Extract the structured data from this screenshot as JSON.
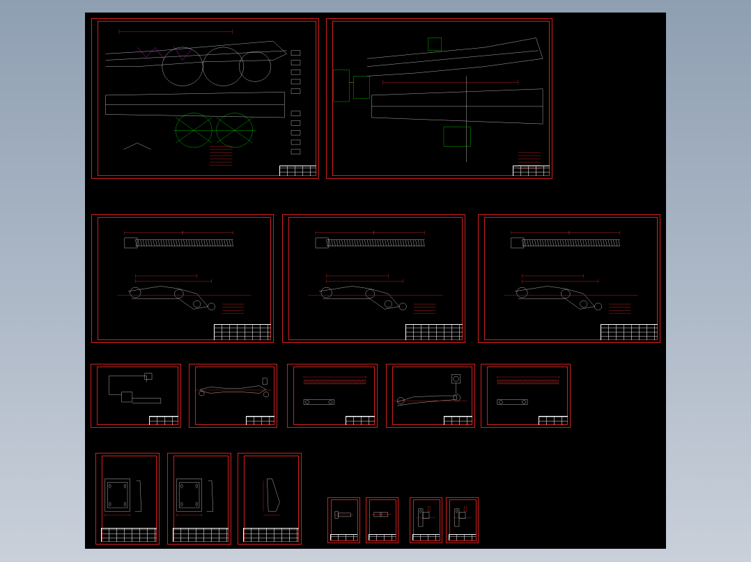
{
  "viewer": {
    "background_top": "#8f9fb2",
    "background_bottom": "#c9d0da",
    "canvas_color": "#000000",
    "frame_color": "#d61f1f"
  },
  "palette": {
    "line": "#ffffff",
    "dimension": "#ff3030",
    "text": "#e7e000",
    "highlight": "#00ff00",
    "accent": "#ff33ff",
    "hidden": "#00d0ff"
  },
  "sheets": [
    {
      "id": "assembly-1",
      "kind": "assembly-chassis"
    },
    {
      "id": "assembly-2",
      "kind": "assembly-frame"
    },
    {
      "id": "lever-1",
      "kind": "rod-and-lever"
    },
    {
      "id": "lever-2",
      "kind": "rod-and-lever"
    },
    {
      "id": "lever-3",
      "kind": "rod-and-lever"
    },
    {
      "id": "part-a",
      "kind": "bracket"
    },
    {
      "id": "part-b",
      "kind": "shaft"
    },
    {
      "id": "part-c",
      "kind": "threaded-rod"
    },
    {
      "id": "part-d",
      "kind": "arm"
    },
    {
      "id": "part-e",
      "kind": "threaded-rod"
    },
    {
      "id": "plate-1",
      "kind": "plate"
    },
    {
      "id": "plate-2",
      "kind": "plate"
    },
    {
      "id": "plate-3",
      "kind": "wedge"
    },
    {
      "id": "small-1",
      "kind": "pin"
    },
    {
      "id": "small-2",
      "kind": "bushing"
    },
    {
      "id": "small-3",
      "kind": "clamp"
    },
    {
      "id": "small-4",
      "kind": "clamp"
    }
  ]
}
